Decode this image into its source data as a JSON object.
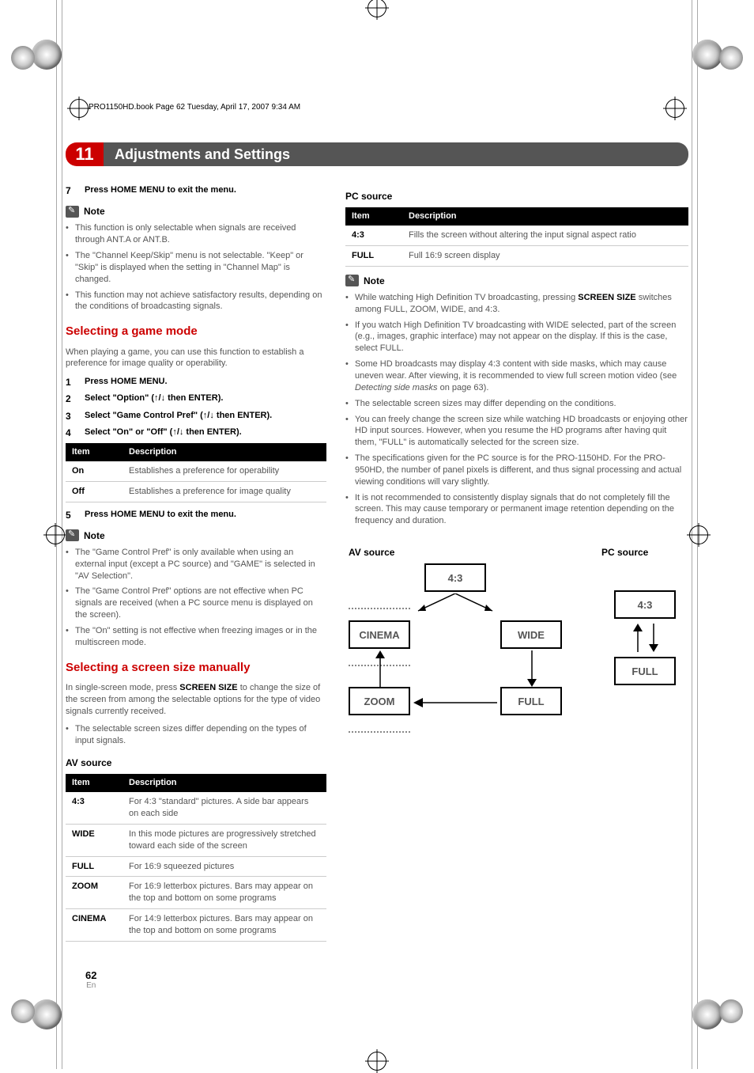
{
  "header_line": "PRO1150HD.book  Page 62  Tuesday, April 17, 2007  9:34 AM",
  "chapter": {
    "number": "11",
    "title": "Adjustments and Settings"
  },
  "left": {
    "step7": {
      "num": "7",
      "text": "Press HOME MENU to exit the menu."
    },
    "note1_title": "Note",
    "note1_bullets": [
      "This function is only selectable when signals are received through ANT.A or ANT.B.",
      "The \"Channel Keep/Skip\" menu is not selectable. \"Keep\" or \"Skip\" is displayed when the setting in \"Channel Map\" is changed.",
      "This function may not achieve satisfactory results, depending on the conditions of broadcasting signals."
    ],
    "game_mode_title": "Selecting a game mode",
    "game_mode_intro": "When playing a game, you can use this function to establish a preference for image quality or operability.",
    "steps_a": [
      {
        "num": "1",
        "text": "Press HOME MENU."
      },
      {
        "num": "2",
        "text": "Select \"Option\" (↑/↓ then ENTER)."
      },
      {
        "num": "3",
        "text": "Select \"Game Control Pref\" (↑/↓ then ENTER)."
      },
      {
        "num": "4",
        "text": "Select \"On\" or \"Off\" (↑/↓ then ENTER)."
      }
    ],
    "table_a_head": {
      "c1": "Item",
      "c2": "Description"
    },
    "table_a_rows": [
      {
        "c1": "On",
        "c2": "Establishes a preference for operability"
      },
      {
        "c1": "Off",
        "c2": "Establishes a preference for image quality"
      }
    ],
    "step5": {
      "num": "5",
      "text": "Press HOME MENU to exit the menu."
    },
    "note2_title": "Note",
    "note2_bullets": [
      "The \"Game Control Pref\" is only available when using an external input (except a PC source) and \"GAME\" is selected in \"AV Selection\".",
      "The \"Game Control Pref\" options are not effective when PC signals are received (when a PC source menu is displayed on the screen).",
      "The \"On\" setting is not effective when freezing images or in the multiscreen mode."
    ],
    "screen_size_title": "Selecting a screen size manually",
    "screen_size_intro_pre": "In single-screen mode, press ",
    "screen_size_intro_bold": "SCREEN SIZE",
    "screen_size_intro_post": " to change the size of the screen from among the selectable options for the type of video signals currently received.",
    "screen_size_bullet": "The selectable screen sizes differ depending on the types of input signals.",
    "av_source_head": "AV source",
    "table_b_head": {
      "c1": "Item",
      "c2": "Description"
    },
    "table_b_rows": [
      {
        "c1": "4:3",
        "c2": "For 4:3 \"standard\" pictures. A side bar appears on each side"
      },
      {
        "c1": "WIDE",
        "c2": "In this mode pictures are progressively stretched toward each side of the screen"
      },
      {
        "c1": "FULL",
        "c2": "For 16:9 squeezed pictures"
      },
      {
        "c1": "ZOOM",
        "c2": "For 16:9 letterbox pictures. Bars may appear on the top and bottom on some programs"
      },
      {
        "c1": "CINEMA",
        "c2": "For 14:9 letterbox pictures. Bars may appear on the top and bottom on some programs"
      }
    ]
  },
  "right": {
    "pc_source_head": "PC source",
    "table_c_head": {
      "c1": "Item",
      "c2": "Description"
    },
    "table_c_rows": [
      {
        "c1": "4:3",
        "c2": "Fills the screen without altering the input signal aspect ratio"
      },
      {
        "c1": "FULL",
        "c2": "Full 16:9 screen display"
      }
    ],
    "note3_title": "Note",
    "note3_bullets_pre": "While watching High Definition TV broadcasting, pressing ",
    "note3_bullets_bold": "SCREEN SIZE",
    "note3_bullets_post": " switches among FULL, ZOOM, WIDE, and 4:3.",
    "note3_rest": [
      "If you watch High Definition TV broadcasting with WIDE selected, part of the screen (e.g., images, graphic interface) may not appear on the display. If this is the case, select FULL.",
      "Some HD broadcasts may display 4:3 content with side masks, which may cause uneven wear. After viewing, it is recommended to view full screen motion video (see Detecting side masks on page 63).",
      "The selectable screen sizes may differ depending on the conditions.",
      "You can freely change the screen size while watching HD broadcasts or enjoying other HD input sources. However, when you resume the HD programs after having quit them, \"FULL\" is automatically selected for the screen size.",
      "The specifications given for the PC source is for the PRO-1150HD. For the PRO-950HD, the number of panel pixels is different, and thus signal processing and actual viewing conditions will vary slightly.",
      "It is not recommended to consistently display signals that do not completely fill the screen. This may cause temporary or permanent image retention depending on the frequency and duration."
    ],
    "diagram": {
      "av_label": "AV source",
      "pc_label": "PC source",
      "b43": "4:3",
      "wide": "WIDE",
      "full": "FULL",
      "zoom": "ZOOM",
      "cinema": "CINEMA"
    }
  },
  "page": {
    "num": "62",
    "lang": "En"
  }
}
